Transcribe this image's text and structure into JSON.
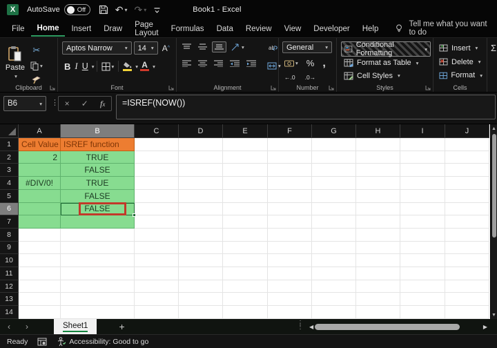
{
  "window": {
    "app_logo": "X",
    "autosave_label": "AutoSave",
    "autosave_state": "Off",
    "title": "Book1  -  Excel"
  },
  "menu": {
    "tabs": [
      {
        "label": "File",
        "active": false
      },
      {
        "label": "Home",
        "active": true
      },
      {
        "label": "Insert",
        "active": false
      },
      {
        "label": "Draw",
        "active": false
      },
      {
        "label": "Page Layout",
        "active": false
      },
      {
        "label": "Formulas",
        "active": false
      },
      {
        "label": "Data",
        "active": false
      },
      {
        "label": "Review",
        "active": false
      },
      {
        "label": "View",
        "active": false
      },
      {
        "label": "Developer",
        "active": false
      },
      {
        "label": "Help",
        "active": false
      }
    ],
    "tell_me": "Tell me what you want to do"
  },
  "ribbon": {
    "clipboard": {
      "label": "Clipboard",
      "paste": "Paste"
    },
    "font": {
      "label": "Font",
      "font_name": "Aptos Narrow",
      "font_size": "14",
      "bold": "B",
      "italic": "I",
      "underline": "U"
    },
    "alignment": {
      "label": "Alignment"
    },
    "number": {
      "label": "Number",
      "format": "General",
      "percent": "%",
      "comma": ",",
      "inc_dec": "←.0",
      "dec_dec": ".0→"
    },
    "styles": {
      "label": "Styles",
      "items": [
        "Conditional Formatting",
        "Format as Table",
        "Cell Styles"
      ]
    },
    "cells": {
      "label": "Cells",
      "items": [
        "Insert",
        "Delete",
        "Format"
      ]
    },
    "editing": {
      "sum": "Σ"
    }
  },
  "formula_bar": {
    "name_box": "B6",
    "formula": "=ISREF(NOW())"
  },
  "grid": {
    "columns": [
      "A",
      "B",
      "C",
      "D",
      "E",
      "F",
      "G",
      "H",
      "I",
      "J"
    ],
    "row_count": 14,
    "selected_cell": "B6",
    "selected_column": "B",
    "selected_row": 6,
    "cells": {
      "A1": {
        "value": "Cell Value",
        "fill": "orange",
        "align": "l"
      },
      "B1": {
        "value": "ISREF function",
        "fill": "orange",
        "align": "l"
      },
      "A2": {
        "value": "2",
        "fill": "green",
        "align": "r"
      },
      "B2": {
        "value": "TRUE",
        "fill": "green",
        "align": "c"
      },
      "A3": {
        "value": "",
        "fill": "green",
        "align": "c"
      },
      "B3": {
        "value": "FALSE",
        "fill": "green",
        "align": "c"
      },
      "A4": {
        "value": "#DIV/0!",
        "fill": "green",
        "align": "c"
      },
      "B4": {
        "value": "TRUE",
        "fill": "green",
        "align": "c"
      },
      "A5": {
        "value": "",
        "fill": "green",
        "align": "c"
      },
      "B5": {
        "value": "FALSE",
        "fill": "green",
        "align": "c"
      },
      "A6": {
        "value": "",
        "fill": "green",
        "align": "c"
      },
      "B6": {
        "value": "FALSE",
        "fill": "green",
        "align": "c",
        "annotated": true
      },
      "A7": {
        "value": "",
        "fill": "green",
        "align": "c"
      },
      "B7": {
        "value": "",
        "fill": "green",
        "align": "c"
      }
    },
    "colors": {
      "green_fill": "#87dc90",
      "green_border": "#5fb36d",
      "green_text": "#1c3a22",
      "orange_fill": "#ed7d31",
      "orange_border": "#c05e15",
      "orange_text": "#7e3506",
      "annotation": "#c2392a",
      "accent": "#107c41"
    }
  },
  "sheet_tabs": {
    "active": "Sheet1",
    "add_label": "+"
  },
  "status_bar": {
    "mode": "Ready",
    "accessibility": "Accessibility: Good to go"
  }
}
